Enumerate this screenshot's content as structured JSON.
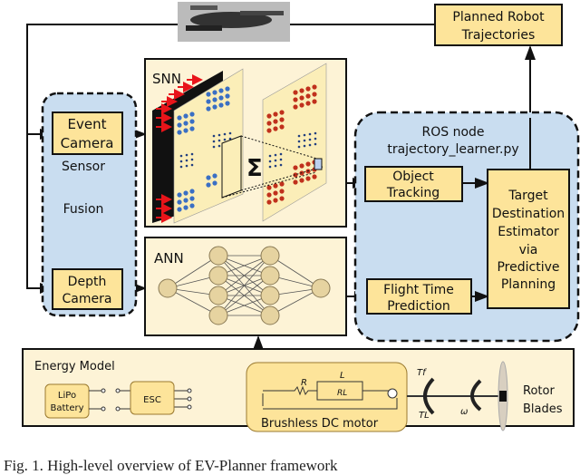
{
  "colors": {
    "box_fill": "#fde49a",
    "panel_fill": "#fdf3d6",
    "ros_fill": "#c9ddf0",
    "snn_blue": "#3a6fc4",
    "snn_red": "#c0301c",
    "arrow_red": "#e8141a"
  },
  "sensor_fusion": {
    "label_line1": "Sensor",
    "label_line2": "Fusion",
    "event_camera": [
      "Event",
      "Camera"
    ],
    "depth_camera": [
      "Depth",
      "Camera"
    ]
  },
  "snn": {
    "label": "SNN",
    "sum_symbol": "Σ"
  },
  "ann": {
    "label": "ANN"
  },
  "ros_node": {
    "title": "ROS node",
    "script": "trajectory_learner.py",
    "object_tracking": [
      "Object",
      "Tracking"
    ],
    "flight_time": [
      "Flight Time",
      "Prediction"
    ],
    "target_estimator": [
      "Target",
      "Destination",
      "Estimator",
      "via",
      "Predictive",
      "Planning"
    ]
  },
  "planned": [
    "Planned Robot",
    "Trajectories"
  ],
  "energy_model": {
    "title": "Energy Model",
    "battery": [
      "LiPo",
      "Battery"
    ],
    "esc": "ESC",
    "motor": "Brushless DC motor",
    "R": "R",
    "L": "L",
    "RL": "RL",
    "Tf": "Tf",
    "TL": "TL",
    "omega": "ω",
    "rotor": [
      "Rotor",
      "Blades"
    ]
  },
  "caption": "Fig. 1.  High-level overview of EV-Planner framework"
}
